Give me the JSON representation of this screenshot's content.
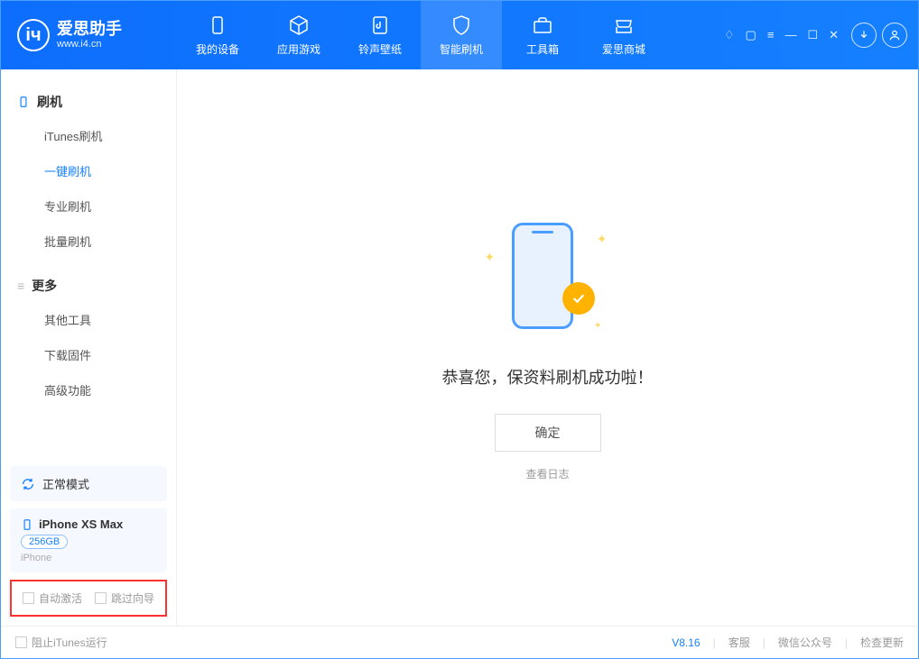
{
  "logo": {
    "title": "爱思助手",
    "subtitle": "www.i4.cn"
  },
  "nav": {
    "tabs": [
      {
        "label": "我的设备"
      },
      {
        "label": "应用游戏"
      },
      {
        "label": "铃声壁纸"
      },
      {
        "label": "智能刷机"
      },
      {
        "label": "工具箱"
      },
      {
        "label": "爱思商城"
      }
    ]
  },
  "sidebar": {
    "group1_title": "刷机",
    "group1_items": [
      "iTunes刷机",
      "一键刷机",
      "专业刷机",
      "批量刷机"
    ],
    "group2_title": "更多",
    "group2_items": [
      "其他工具",
      "下载固件",
      "高级功能"
    ],
    "mode_label": "正常模式",
    "device": {
      "name": "iPhone XS Max",
      "storage": "256GB",
      "type": "iPhone"
    },
    "cb1": "自动激活",
    "cb2": "跳过向导"
  },
  "main": {
    "success_text": "恭喜您，保资料刷机成功啦！",
    "confirm": "确定",
    "log_link": "查看日志"
  },
  "footer": {
    "block_itunes": "阻止iTunes运行",
    "version": "V8.16",
    "support": "客服",
    "wechat": "微信公众号",
    "update": "检查更新"
  }
}
